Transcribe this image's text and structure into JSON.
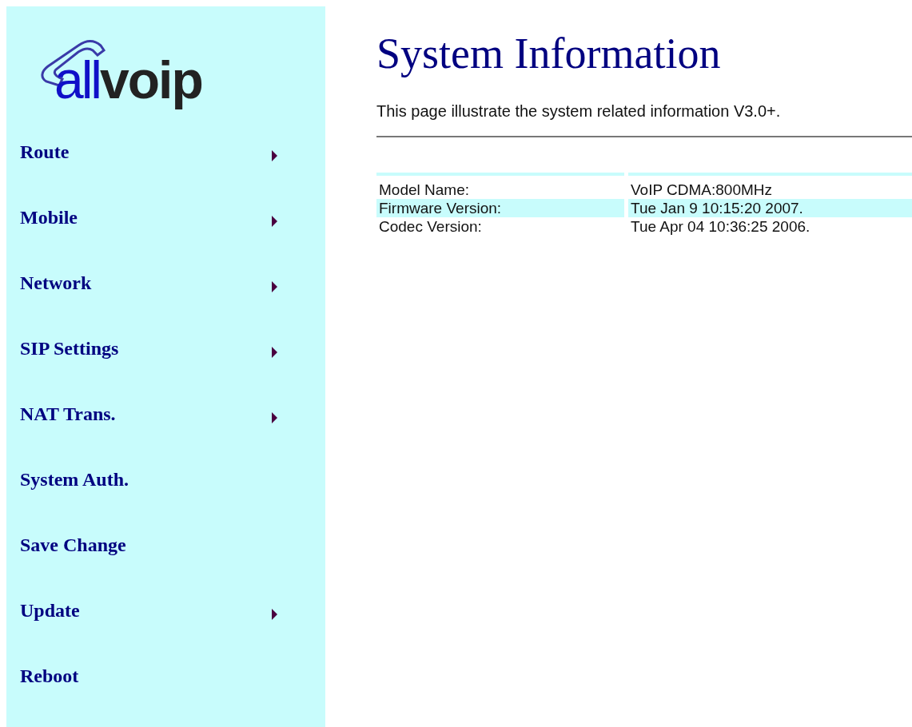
{
  "logo": {
    "part_1": "all",
    "part_2": "voip"
  },
  "sidebar": {
    "items": [
      {
        "label": "Route",
        "has_submenu": true
      },
      {
        "label": "Mobile",
        "has_submenu": true
      },
      {
        "label": "Network",
        "has_submenu": true
      },
      {
        "label": "SIP Settings",
        "has_submenu": true
      },
      {
        "label": "NAT Trans.",
        "has_submenu": true
      },
      {
        "label": "System Auth.",
        "has_submenu": false
      },
      {
        "label": "Save Change",
        "has_submenu": false
      },
      {
        "label": "Update",
        "has_submenu": true
      },
      {
        "label": "Reboot",
        "has_submenu": false
      }
    ]
  },
  "main": {
    "title": "System Information",
    "description": "This page illustrate the system related information V3.0+.",
    "table": {
      "rows": [
        {
          "label": "Model Name:",
          "value": "VoIP CDMA:800MHz",
          "highlighted": false
        },
        {
          "label": "Firmware Version:",
          "value": "Tue Jan 9 10:15:20 2007.",
          "highlighted": true
        },
        {
          "label": "Codec Version:",
          "value": "Tue Apr 04 10:36:25 2006.",
          "highlighted": false
        }
      ]
    }
  }
}
